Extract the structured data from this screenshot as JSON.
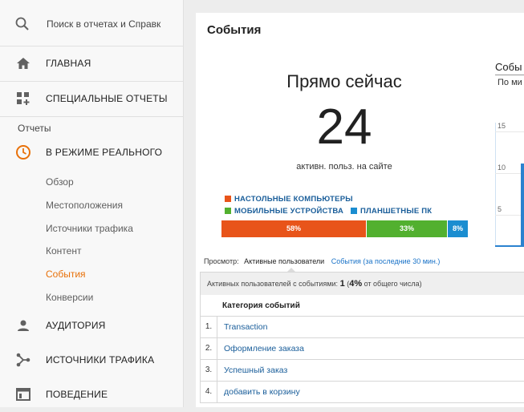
{
  "sidebar": {
    "search_placeholder": "Поиск в отчетах и Справк",
    "home_label": "ГЛАВНАЯ",
    "custom_reports_label": "СПЕЦИАЛЬНЫЕ ОТЧЕТЫ",
    "reports_section_label": "Отчеты",
    "realtime_label": "В РЕЖИМЕ РЕАЛЬНОГО",
    "realtime_items": [
      "Обзор",
      "Местоположения",
      "Источники трафика",
      "Контент",
      "События",
      "Конверсии"
    ],
    "active_item": "События",
    "audience_label": "АУДИТОРИЯ",
    "acquisition_label": "ИСТОЧНИКИ ТРАФИКА",
    "behavior_label": "ПОВЕДЕНИЕ"
  },
  "main": {
    "title": "События",
    "right_now": {
      "heading": "Прямо сейчас",
      "count": "24",
      "caption": "активн. польз. на сайте"
    },
    "devices": [
      {
        "label": "НАСТОЛЬНЫЕ КОМПЬЮТЕРЫ",
        "percent": 58,
        "percent_label": "58%",
        "color": "#e8541a"
      },
      {
        "label": "МОБИЛЬНЫЕ УСТРОЙСТВА",
        "percent": 33,
        "percent_label": "33%",
        "color": "#52b02f"
      },
      {
        "label": "ПЛАНШЕТНЫЕ ПК",
        "percent": 8,
        "percent_label": "8%",
        "color": "#1b8dd0"
      }
    ],
    "view": {
      "label": "Просмотр:",
      "active_tab": "Активные пользователи",
      "other_tab": "События (за последние 30 мин.)"
    },
    "summary": {
      "prefix": "Активных пользователей с событиями:",
      "count": "1",
      "pct_open": "(",
      "pct": "4%",
      "suffix": "от общего числа)"
    },
    "table": {
      "header": "Категория событий",
      "rows": [
        {
          "num": "1.",
          "name": "Transaction"
        },
        {
          "num": "2.",
          "name": "Оформление заказа"
        },
        {
          "num": "3.",
          "name": "Успешный заказ"
        },
        {
          "num": "4.",
          "name": "добавить в корзину"
        }
      ]
    },
    "chart": {
      "title": "Собы",
      "subtitle": "По ми",
      "y_ticks": [
        "15",
        "10",
        "5"
      ]
    }
  }
}
